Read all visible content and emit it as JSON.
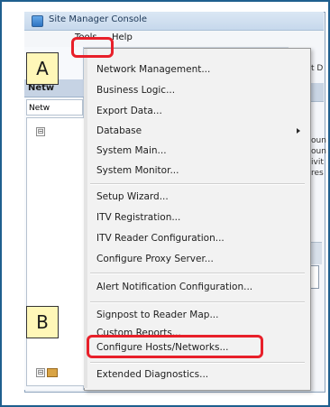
{
  "window": {
    "title": "Site Manager Console",
    "icon": "app-icon"
  },
  "menubar": {
    "items": [
      {
        "label": "Tools",
        "state": "open"
      },
      {
        "label": "Help"
      }
    ]
  },
  "left_panel": {
    "header": "Netw",
    "tab_label": "Netw",
    "tree": {
      "expanders": [
        "⊟",
        "⊟"
      ]
    }
  },
  "right_panel": {
    "fragments": [
      "t D",
      "oun",
      "oun",
      "ivit",
      "res"
    ]
  },
  "tools_menu": {
    "groups": [
      [
        "Network Management...",
        "Business Logic...",
        "Export Data...",
        "Database",
        "System Main...",
        "System Monitor..."
      ],
      [
        "Setup Wizard...",
        "ITV Registration...",
        "ITV Reader Configuration...",
        "Configure Proxy Server..."
      ],
      [
        "Alert Notification Configuration..."
      ],
      [
        "Signpost to Reader Map...",
        "Custom Reports...",
        "Configure Hosts/Networks..."
      ],
      [
        "Extended Diagnostics..."
      ]
    ],
    "submenu_item": "Database"
  },
  "annotations": {
    "callouts": [
      "A",
      "B"
    ],
    "highlight_color": "#e8202a",
    "callout_fill": "#fff7b8"
  }
}
